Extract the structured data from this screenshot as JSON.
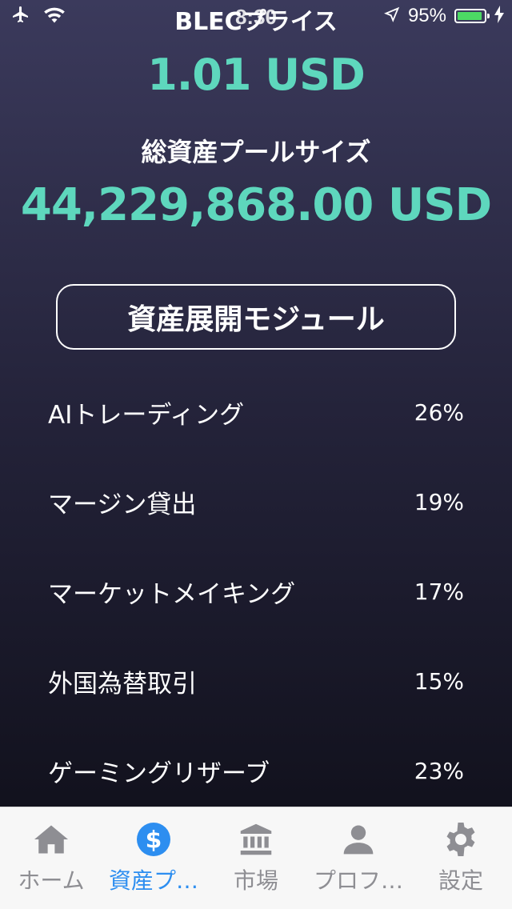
{
  "status_bar": {
    "time": "8:30",
    "battery_percent": "95%",
    "battery_level": 0.95,
    "icons": [
      "airplane-icon",
      "wifi-icon",
      "location-arrow-icon",
      "battery-icon",
      "charging-bolt-icon"
    ]
  },
  "nav": {
    "title": "BLECプライス"
  },
  "price": {
    "value": "1.01 USD"
  },
  "pool": {
    "label": "総資産プールサイズ",
    "value": "44,229,868.00 USD"
  },
  "module": {
    "button_label": "資産展開モジュール",
    "items": [
      {
        "name": "AIトレーディング",
        "percent": "26%"
      },
      {
        "name": "マージン貸出",
        "percent": "19%"
      },
      {
        "name": "マーケットメイキング",
        "percent": "17%"
      },
      {
        "name": "外国為替取引",
        "percent": "15%"
      },
      {
        "name": "ゲーミングリザーブ",
        "percent": "23%"
      }
    ]
  },
  "tabs": [
    {
      "label": "ホーム",
      "icon": "home-icon",
      "active": false
    },
    {
      "label": "資産プ…",
      "icon": "dollar-icon",
      "active": true
    },
    {
      "label": "市場",
      "icon": "bank-icon",
      "active": false
    },
    {
      "label": "プロフ…",
      "icon": "person-icon",
      "active": false
    },
    {
      "label": "設定",
      "icon": "gear-icon",
      "active": false
    }
  ],
  "colors": {
    "accent": "#5ed7bd",
    "tab_active": "#2d8ef0",
    "tab_inactive": "#8e8e93",
    "battery": "#4cd964"
  }
}
